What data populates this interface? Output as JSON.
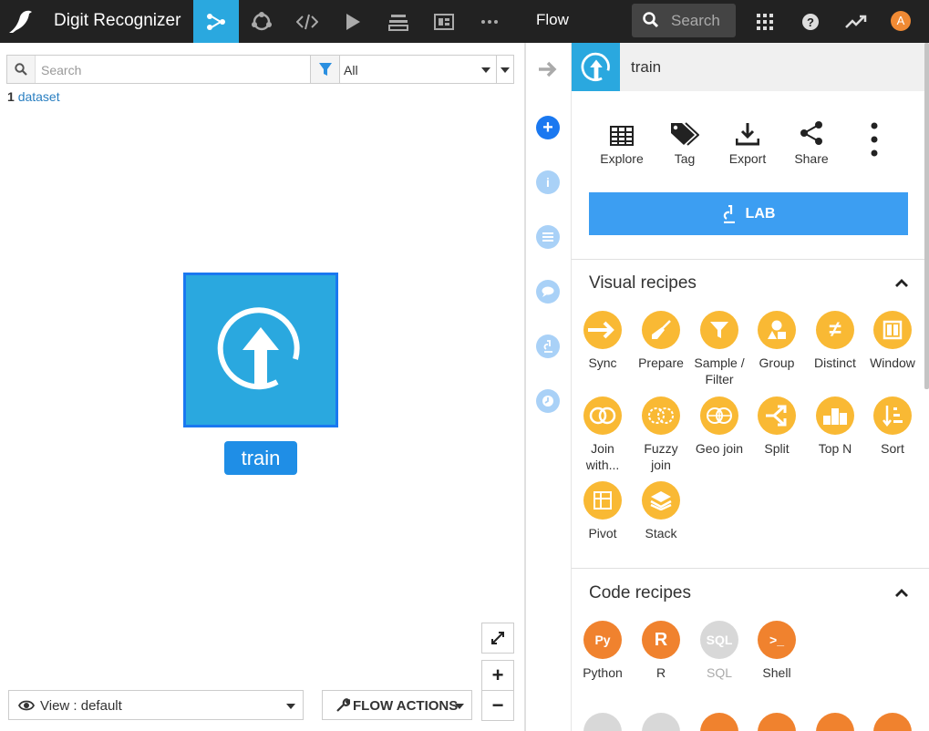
{
  "header": {
    "project_title": "Digit Recognizer",
    "current_view": "Flow",
    "search_placeholder": "Search",
    "avatar_letter": "A",
    "accent": "#2aa8df",
    "bg": "#222222"
  },
  "left": {
    "search_placeholder": "Search",
    "filter_value": "All",
    "count": "1",
    "count_label": "dataset",
    "node_label": "train",
    "view_label": "View : default",
    "flow_actions_label": "FLOW ACTIONS",
    "zoom_in": "+",
    "zoom_out": "−"
  },
  "panel": {
    "dataset_name": "train",
    "actions": [
      {
        "label": "Explore",
        "icon": "table-icon"
      },
      {
        "label": "Tag",
        "icon": "tag-icon"
      },
      {
        "label": "Export",
        "icon": "download-icon"
      },
      {
        "label": "Share",
        "icon": "share-icon"
      }
    ],
    "lab_label": "LAB",
    "visual_title": "Visual recipes",
    "visual_recipes": [
      {
        "label": "Sync",
        "icon": "arrow-right-icon"
      },
      {
        "label": "Prepare",
        "icon": "broom-icon"
      },
      {
        "label": "Sample / Filter",
        "icon": "funnel-icon"
      },
      {
        "label": "Group",
        "icon": "shapes-icon"
      },
      {
        "label": "Distinct",
        "icon": "not-equal-icon"
      },
      {
        "label": "Window",
        "icon": "window-icon"
      },
      {
        "label": "Join with...",
        "icon": "join-icon"
      },
      {
        "label": "Fuzzy join",
        "icon": "fuzzy-join-icon"
      },
      {
        "label": "Geo join",
        "icon": "globe-join-icon"
      },
      {
        "label": "Split",
        "icon": "split-icon"
      },
      {
        "label": "Top N",
        "icon": "podium-icon"
      },
      {
        "label": "Sort",
        "icon": "sort-icon"
      },
      {
        "label": "Pivot",
        "icon": "pivot-icon"
      },
      {
        "label": "Stack",
        "icon": "layers-icon"
      }
    ],
    "code_title": "Code recipes",
    "code_recipes": [
      {
        "label": "Python",
        "icon": "python-icon",
        "glyph": "Py"
      },
      {
        "label": "R",
        "icon": "r-icon",
        "glyph": "R"
      },
      {
        "label": "SQL",
        "icon": "sql-icon",
        "glyph": "SQL"
      },
      {
        "label": "Shell",
        "icon": "terminal-icon",
        "glyph": ">_"
      }
    ]
  }
}
